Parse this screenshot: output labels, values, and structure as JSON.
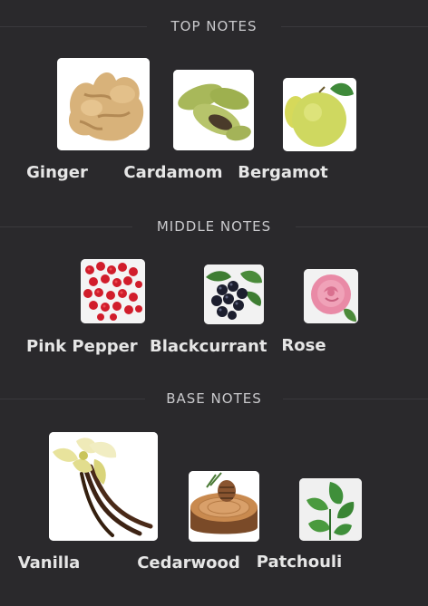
{
  "sections": [
    {
      "title": "TOP NOTES",
      "notes": [
        {
          "label": "Ginger",
          "icon": "ginger-icon"
        },
        {
          "label": "Cardamom",
          "icon": "cardamom-icon"
        },
        {
          "label": "Bergamot",
          "icon": "bergamot-icon"
        }
      ]
    },
    {
      "title": "MIDDLE NOTES",
      "notes": [
        {
          "label": "Pink Pepper",
          "icon": "pink-pepper-icon"
        },
        {
          "label": "Blackcurrant",
          "icon": "blackcurrant-icon"
        },
        {
          "label": "Rose",
          "icon": "rose-icon"
        }
      ]
    },
    {
      "title": "BASE NOTES",
      "notes": [
        {
          "label": "Vanilla",
          "icon": "vanilla-icon"
        },
        {
          "label": "Cedarwood",
          "icon": "cedarwood-icon"
        },
        {
          "label": "Patchouli",
          "icon": "patchouli-icon"
        }
      ]
    }
  ],
  "colors": {
    "background": "#2a292c",
    "text": "#e6e6e6",
    "header_text": "#c9c9cc",
    "rule": "#3a393d"
  }
}
